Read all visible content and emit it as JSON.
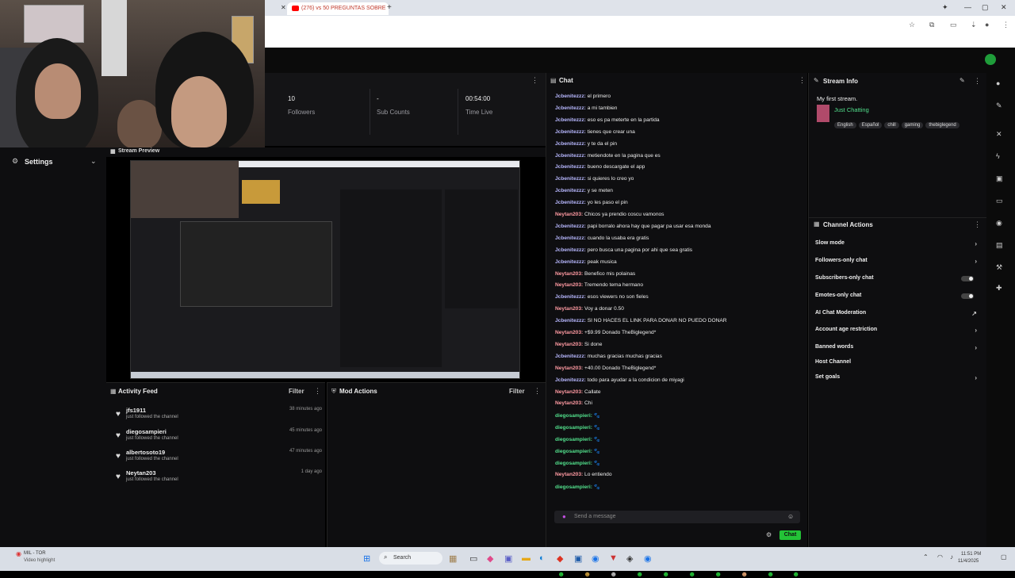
{
  "browser": {
    "tab_title": "(276) vs 50 PREGUNTAS SOBRE",
    "new_tab": "+"
  },
  "stats": {
    "followers": {
      "value": "10",
      "label": "Followers"
    },
    "subs": {
      "value": "-",
      "label": "Sub Counts"
    },
    "time": {
      "value": "00:54:00",
      "label": "Time Live"
    }
  },
  "left": {
    "settings_label": "Settings"
  },
  "preview": {
    "title": "Stream Preview"
  },
  "activity": {
    "title": "Activity Feed",
    "filter": "Filter",
    "items": [
      {
        "name": "jfs1911",
        "sub": "just followed the channel",
        "time": "38 minutes ago"
      },
      {
        "name": "diegosampieri",
        "sub": "just followed the channel",
        "time": "45 minutes ago"
      },
      {
        "name": "albertosoto19",
        "sub": "just followed the channel",
        "time": "47 minutes ago"
      },
      {
        "name": "Neytan203",
        "sub": "just followed the channel",
        "time": "1 day ago"
      }
    ]
  },
  "mod": {
    "title": "Mod Actions",
    "filter": "Filter"
  },
  "chat": {
    "title": "Chat",
    "placeholder": "Send a message",
    "send_label": "Chat",
    "messages": [
      {
        "user": "Jcbenitezzz:",
        "text": "el primero",
        "c": "u1"
      },
      {
        "user": "Jcbenitezzz:",
        "text": "a mi tambien",
        "c": "u1"
      },
      {
        "user": "Jcbenitezzz:",
        "text": "eso es pa meterte en la partida",
        "c": "u1"
      },
      {
        "user": "Jcbenitezzz:",
        "text": "tienes que crear una",
        "c": "u1"
      },
      {
        "user": "Jcbenitezzz:",
        "text": "y te da el pin",
        "c": "u1"
      },
      {
        "user": "Jcbenitezzz:",
        "text": "metiendote en la pagina que es",
        "c": "u1"
      },
      {
        "user": "Jcbenitezzz:",
        "text": "bueno descargate el app",
        "c": "u1"
      },
      {
        "user": "Jcbenitezzz:",
        "text": "si quieres lo creo yo",
        "c": "u1"
      },
      {
        "user": "Jcbenitezzz:",
        "text": "y se meten",
        "c": "u1"
      },
      {
        "user": "Jcbenitezzz:",
        "text": "yo les paso el pin",
        "c": "u1"
      },
      {
        "user": "Neytan203:",
        "text": "Chicos ya prendio coscu vamonos",
        "c": "u2"
      },
      {
        "user": "Jcbenitezzz:",
        "text": "papi borralo ahora hay que pagar pa usar esa monda",
        "c": "u1"
      },
      {
        "user": "Jcbenitezzz:",
        "text": "cuando la usaba era gratis",
        "c": "u1"
      },
      {
        "user": "Jcbenitezzz:",
        "text": "pero busca una pagina por ahi que sea gratis",
        "c": "u1"
      },
      {
        "user": "Jcbenitezzz:",
        "text": "peak musica",
        "c": "u1"
      },
      {
        "user": "Neytan203:",
        "text": "Benefico mis polainas",
        "c": "u2"
      },
      {
        "user": "Neytan203:",
        "text": "Tremendo tema hermano",
        "c": "u2"
      },
      {
        "user": "Jcbenitezzz:",
        "text": "esos viewers no son fieles",
        "c": "u1"
      },
      {
        "user": "Neytan203:",
        "text": "Voy a donar 0.50",
        "c": "u2"
      },
      {
        "user": "Jcbenitezzz:",
        "text": "SI NO HACES EL LINK PARA DONAR NO PUEDO DONAR",
        "c": "u1"
      },
      {
        "user": "Neytan203:",
        "text": "+$9.99 Donado TheBiglegend*",
        "c": "u2"
      },
      {
        "user": "Neytan203:",
        "text": "Si done",
        "c": "u2"
      },
      {
        "user": "Jcbenitezzz:",
        "text": "muchas gracias muchas gracias",
        "c": "u1"
      },
      {
        "user": "Neytan203:",
        "text": "+40.00 Donado TheBiglegend*",
        "c": "u2"
      },
      {
        "user": "Jcbenitezzz:",
        "text": "todo para ayudar a la condicion de miyagi",
        "c": "u1"
      },
      {
        "user": "Neytan203:",
        "text": "Callate",
        "c": "u2"
      },
      {
        "user": "Neytan203:",
        "text": "Chi",
        "c": "u2"
      },
      {
        "user": "diegosampieri:",
        "text": "🐾",
        "c": "u3"
      },
      {
        "user": "diegosampieri:",
        "text": "🐾",
        "c": "u3"
      },
      {
        "user": "diegosampieri:",
        "text": "🐾",
        "c": "u3"
      },
      {
        "user": "diegosampieri:",
        "text": "🐾",
        "c": "u3"
      },
      {
        "user": "diegosampieri:",
        "text": "🐾",
        "c": "u3"
      },
      {
        "user": "Neytan203:",
        "text": "Lo entiendo",
        "c": "u2"
      },
      {
        "user": "diegosampieri:",
        "text": "🐾",
        "c": "u3"
      }
    ]
  },
  "stream_info": {
    "title": "Stream Info",
    "stream_title": "My first stream.",
    "category": "Just Chatting",
    "tags": [
      "English",
      "Español",
      "chill",
      "gaming",
      "thebiglegend"
    ]
  },
  "channel_actions": {
    "title": "Channel Actions",
    "items": [
      "Slow mode",
      "Followers-only chat",
      "Subscribers-only chat",
      "Emotes-only chat",
      "AI Chat Moderation",
      "Account age restriction",
      "Banned words",
      "Host Channel",
      "Set goals"
    ]
  },
  "taskbar": {
    "search": "Search",
    "notif_title": "MIL - TOR",
    "notif_sub": "Video highlight",
    "time": "11:51 PM",
    "date": "11/4/2025"
  },
  "colors": {
    "accent": "#23c337",
    "bg": "#0e0e10"
  }
}
